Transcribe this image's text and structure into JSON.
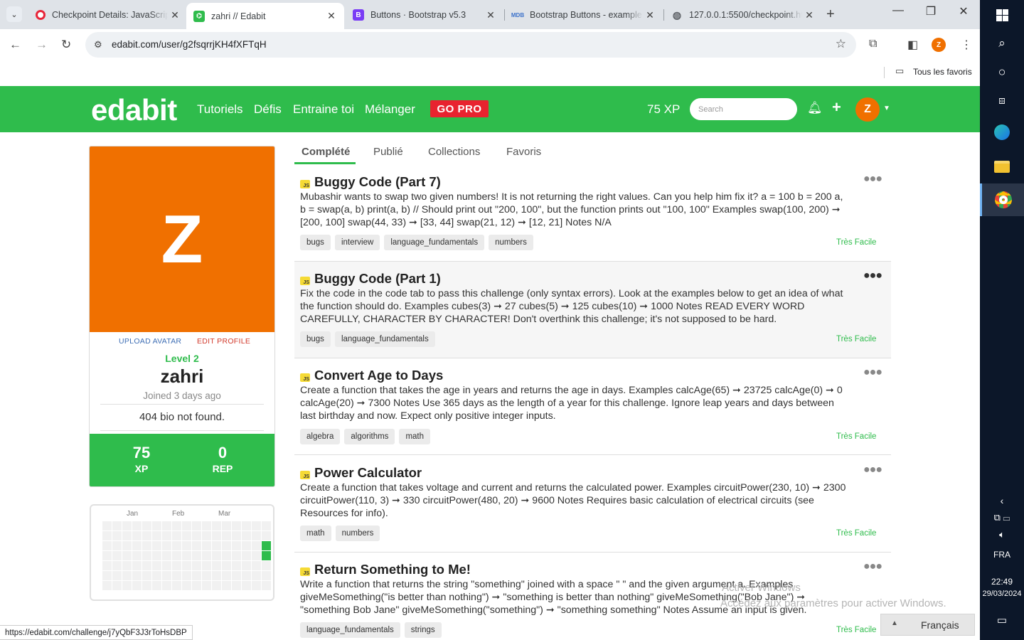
{
  "browser": {
    "tabs": [
      {
        "title": "Checkpoint Details: JavaScrip",
        "favicon": "opera-icon",
        "color": "#e8263a"
      },
      {
        "title": "zahri // Edabit",
        "favicon": "edabit-icon",
        "color": "#2fbc4c"
      },
      {
        "title": "Buttons · Bootstrap v5.3",
        "favicon": "bootstrap-icon",
        "color": "#7a3cf5"
      },
      {
        "title": "Bootstrap Buttons - example",
        "favicon": "mdb-icon",
        "color": "#3b71ca"
      },
      {
        "title": "127.0.0.1:5500/checkpoint.ht",
        "favicon": "globe-icon",
        "color": "#5f6368"
      }
    ],
    "address": "edabit.com/user/g2fsqrrjKH4fXFTqH",
    "profile_initial": "Z",
    "bookmarks_folder": "Tous les favoris"
  },
  "header": {
    "logo": "edabit",
    "nav": [
      "Tutoriels",
      "Défis",
      "Entraine toi",
      "Mélanger"
    ],
    "go_pro": "GO PRO",
    "xp": "75 XP",
    "search_placeholder": "Search",
    "avatar_initial": "Z"
  },
  "profile": {
    "avatar_letter": "Z",
    "upload_avatar": "UPLOAD AVATAR",
    "edit_profile": "EDIT PROFILE",
    "level": "Level 2",
    "username": "zahri",
    "joined": "Joined 3 days ago",
    "bio": "404 bio not found.",
    "stats": [
      {
        "value": "75",
        "label": "XP"
      },
      {
        "value": "0",
        "label": "REP"
      }
    ]
  },
  "calendar": {
    "months": [
      "Jan",
      "Feb",
      "Mar"
    ],
    "active_color": "#2fbc4c"
  },
  "profile_tabs": [
    "Complété",
    "Publié",
    "Collections",
    "Favoris"
  ],
  "challenges": [
    {
      "title": "Buggy Code (Part 7)",
      "lang": "JS",
      "description": "Mubashir wants to swap two given numbers! It is not returning the right values. Can you help him fix it? a = 100 b = 200 a, b = swap(a, b) print(a, b) // Should print out \"200, 100\", but the function prints out \"100, 100\" Examples swap(100, 200) ➞ [200, 100] swap(44, 33) ➞ [33, 44] swap(21, 12) ➞ [12, 21] Notes N/A",
      "tags": [
        "bugs",
        "interview",
        "language_fundamentals",
        "numbers"
      ],
      "difficulty": "Très Facile"
    },
    {
      "title": "Buggy Code (Part 1)",
      "lang": "JS",
      "description": "Fix the code in the code tab to pass this challenge (only syntax errors). Look at the examples below to get an idea of what the function should do. Examples cubes(3) ➞ 27 cubes(5) ➞ 125 cubes(10) ➞ 1000 Notes READ EVERY WORD CAREFULLY, CHARACTER BY CHARACTER! Don't overthink this challenge; it's not supposed to be hard.",
      "tags": [
        "bugs",
        "language_fundamentals"
      ],
      "difficulty": "Très Facile"
    },
    {
      "title": "Convert Age to Days",
      "lang": "JS",
      "description": "Create a function that takes the age in years and returns the age in days. Examples calcAge(65) ➞ 23725 calcAge(0) ➞ 0 calcAge(20) ➞ 7300 Notes Use 365 days as the length of a year for this challenge. Ignore leap years and days between last birthday and now. Expect only positive integer inputs.",
      "tags": [
        "algebra",
        "algorithms",
        "math"
      ],
      "difficulty": "Très Facile"
    },
    {
      "title": "Power Calculator",
      "lang": "JS",
      "description": "Create a function that takes voltage and current and returns the calculated power. Examples circuitPower(230, 10) ➞ 2300 circuitPower(110, 3) ➞ 330 circuitPower(480, 20) ➞ 9600 Notes Requires basic calculation of electrical circuits (see Resources for info).",
      "tags": [
        "math",
        "numbers"
      ],
      "difficulty": "Très Facile"
    },
    {
      "title": "Return Something to Me!",
      "lang": "JS",
      "description": "Write a function that returns the string \"something\" joined with a space \" \" and the given argument a. Examples giveMeSomething(\"is better than nothing\") ➞ \"something is better than nothing\" giveMeSomething(\"Bob Jane\") ➞ \"something Bob Jane\" giveMeSomething(\"something\") ➞ \"something something\" Notes Assume an input is given.",
      "tags": [
        "language_fundamentals",
        "strings"
      ],
      "difficulty": "Très Facile"
    }
  ],
  "status_url": "https://edabit.com/challenge/j7yQbF3J3rToHsDBP",
  "watermark": [
    "Activer Windows",
    "Accédez aux paramètres pour activer Windows."
  ],
  "language_widget": "Français",
  "taskbar": {
    "lang": "FRA",
    "time": "22:49",
    "date": "29/03/2024"
  }
}
